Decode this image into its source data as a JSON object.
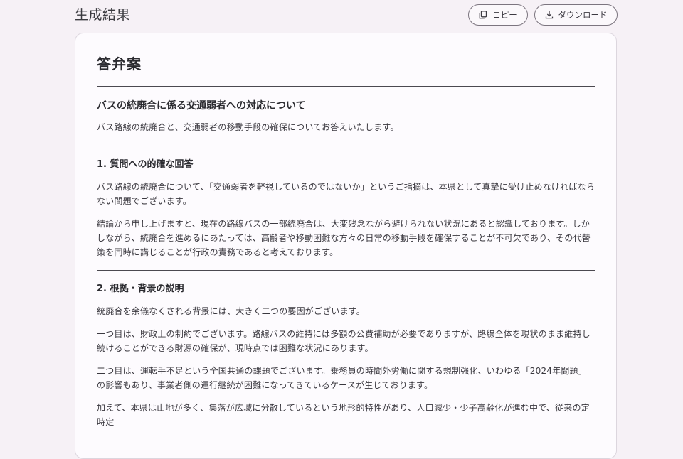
{
  "header": {
    "title": "生成結果",
    "copy_label": "コピー",
    "download_label": "ダウンロード"
  },
  "document": {
    "title": "答弁案",
    "subtitle": "バスの統廃合に係る交通弱者への対応について",
    "intro": "バス路線の統廃合と、交通弱者の移動手段の確保についてお答えいたします。",
    "sections": [
      {
        "heading": "1. 質問への的確な回答",
        "paragraphs": [
          "バス路線の統廃合について、「交通弱者を軽視しているのではないか」というご指摘は、本県として真摯に受け止めなければならない問題でございます。",
          "結論から申し上げますと、現在の路線バスの一部統廃合は、大変残念ながら避けられない状況にあると認識しております。しかしながら、統廃合を進めるにあたっては、高齢者や移動困難な方々の日常の移動手段を確保することが不可欠であり、その代替策を同時に講じることが行政の責務であると考えております。"
        ]
      },
      {
        "heading": "2. 根拠・背景の説明",
        "paragraphs": [
          "統廃合を余儀なくされる背景には、大きく二つの要因がございます。",
          "一つ目は、財政上の制約でございます。路線バスの維持には多額の公費補助が必要でありますが、路線全体を現状のまま維持し続けることができる財源の確保が、現時点では困難な状況にあります。",
          "二つ目は、運転手不足という全国共通の課題でございます。乗務員の時間外労働に関する規制強化、いわゆる「2024年問題」の影響もあり、事業者側の運行継続が困難になってきているケースが生じております。",
          "加えて、本県は山地が多く、集落が広域に分散しているという地形的特性があり、人口減少・少子高齢化が進む中で、従来の定時定"
        ]
      }
    ]
  },
  "icons": {
    "copy": "copy-icon",
    "download": "download-icon"
  },
  "colors": {
    "background": "#f6f1f6",
    "card": "#fdfbfe",
    "button_border": "#7c757f",
    "text": "#2a2a2e"
  }
}
